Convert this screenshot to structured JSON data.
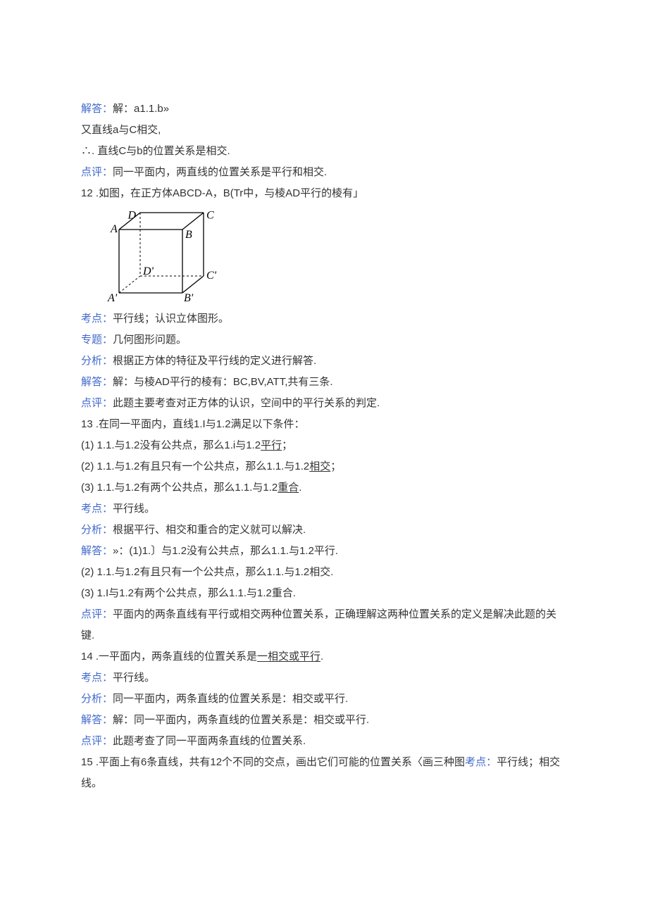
{
  "lines": {
    "l1": {
      "label": "解答：",
      "text": "解：a1.1.b»"
    },
    "l2": "又直线a与C相交,",
    "l3": "∴. 直线C与b的位置关系是相交.",
    "l4": {
      "label": "点评：",
      "text": "同一平面内，两直线的位置关系是平行和相交."
    },
    "l5": "12 .如图，在正方体ABCD-A，B(Tr中，与棱AD平行的棱有」",
    "cube": {
      "D": "D",
      "C": "C",
      "A": "A",
      "B": "B",
      "Dp": "D'",
      "Cp": "C'",
      "Ap": "A'",
      "Bp": "B'"
    },
    "l6": {
      "label": "考点：",
      "text": "平行线；认识立体图形。"
    },
    "l7": {
      "label": "专题：",
      "text": "几何图形问题。"
    },
    "l8": {
      "label": "分析：",
      "text": "根据正方体的特征及平行线的定义进行解答."
    },
    "l9": {
      "label": "解答：",
      "text": "解：与棱AD平行的棱有：BC,BV,ATT,共有三条."
    },
    "l10": {
      "label": "点评：",
      "text": "此题主要考查对正方体的认识，空间中的平行关系的判定."
    },
    "l11": "13 .在同一平面内，直线1.I与1.2满足以下条件：",
    "l12": {
      "pre": "(1)   1.1.与1.2没有公共点，那么1.i与1.2",
      "u": "平行",
      "post": "；"
    },
    "l13": {
      "pre": "(2)   1.1.与1.2有且只有一个公共点，那么1.1.与1.2",
      "u": "相交",
      "post": "；"
    },
    "l14": {
      "pre": "(3)   1.1.与1.2有两个公共点，那么1.1.与1.2",
      "u": "重合",
      "post": "."
    },
    "l15": {
      "label": "考点：",
      "text": "平行线。"
    },
    "l16": {
      "label": "分析：",
      "text": "根据平行、相交和重合的定义就可以解决."
    },
    "l17": {
      "label": "解答：",
      "text": "»：(1)1.〕与1.2没有公共点，那么1.1.与1.2平行."
    },
    "l18": "(2)   1.1.与1.2有且只有一个公共点，那么1.1.与1.2相交.",
    "l19": "(3)   1.I与1.2有两个公共点，那么1.1.与1.2重合.",
    "l20": {
      "label": "点评：",
      "text": "平面内的两条直线有平行或相交两种位置关系，正确理解这两种位置关系的定义是解决此题的关键."
    },
    "l21": {
      "pre": "14 .一平面内，两条直线的位置关系是",
      "u": "一相交或平行",
      "post": "."
    },
    "l22": {
      "label": "考点：",
      "text": "平行线。"
    },
    "l23": {
      "label": "分析：",
      "text": "同一平面内，两条直线的位置关系是：相交或平行."
    },
    "l24": {
      "label": "解答：",
      "text": "解：同一平面内，两条直线的位置关系是：相交或平行."
    },
    "l25": {
      "label": "点评：",
      "text": "此题考查了同一平面两条直线的位置关系."
    },
    "l26": {
      "pre": "15 .平面上有6条直线，共有12个不同的交点，画出它们可能的位置关系〈画三种图",
      "label": "考点：",
      "post": "平行线；相交线。"
    }
  }
}
